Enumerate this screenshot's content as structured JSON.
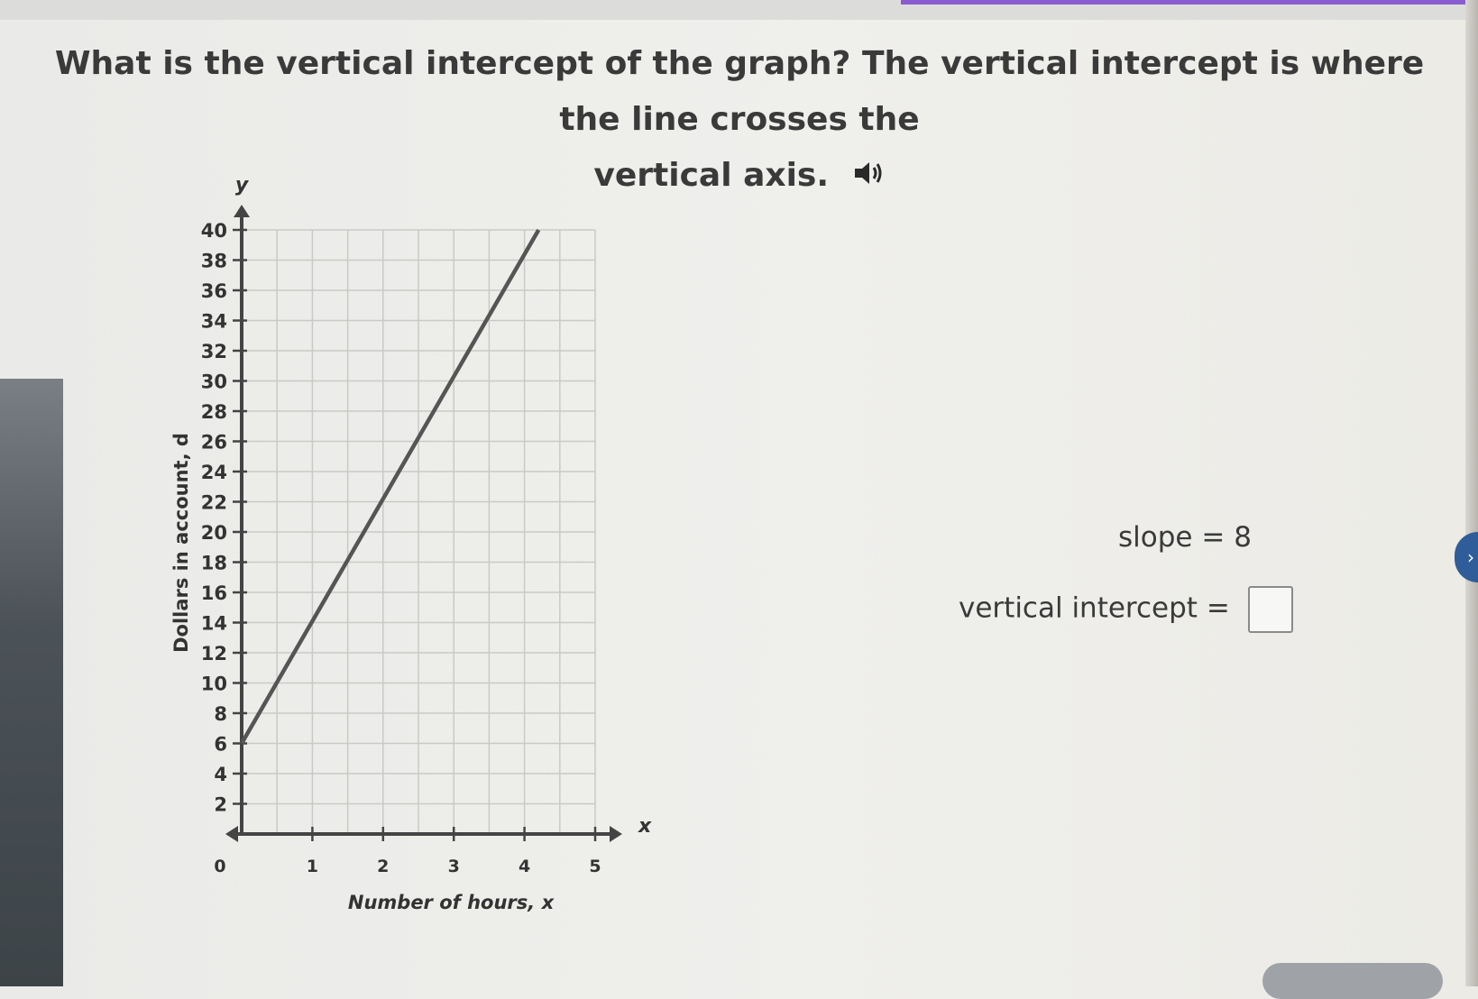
{
  "question": {
    "line1": "What is the vertical intercept of the graph? The vertical intercept is where the line crosses the",
    "line2": "vertical axis."
  },
  "graph": {
    "y_label": "Dollars in account, d",
    "y_symbol": "y",
    "x_label": "Number of hours, x",
    "x_symbol": "x"
  },
  "chart_data": {
    "type": "line",
    "xlabel": "Number of hours, x",
    "ylabel": "Dollars in account, d",
    "xlim": [
      0,
      5
    ],
    "ylim": [
      0,
      40
    ],
    "x_ticks": [
      "0",
      "1",
      "2",
      "3",
      "4",
      "5"
    ],
    "y_ticks": [
      "2",
      "4",
      "6",
      "8",
      "10",
      "12",
      "14",
      "16",
      "18",
      "20",
      "22",
      "24",
      "26",
      "28",
      "30",
      "32",
      "34",
      "36",
      "38",
      "40"
    ],
    "grid": true,
    "series": [
      {
        "x": [
          0,
          4.2
        ],
        "y": [
          6,
          40
        ]
      }
    ],
    "line_color": "#555555"
  },
  "answer": {
    "slope_label": "slope",
    "equals": "=",
    "slope_value": "8",
    "intercept_label": "vertical intercept",
    "intercept_value": ""
  }
}
